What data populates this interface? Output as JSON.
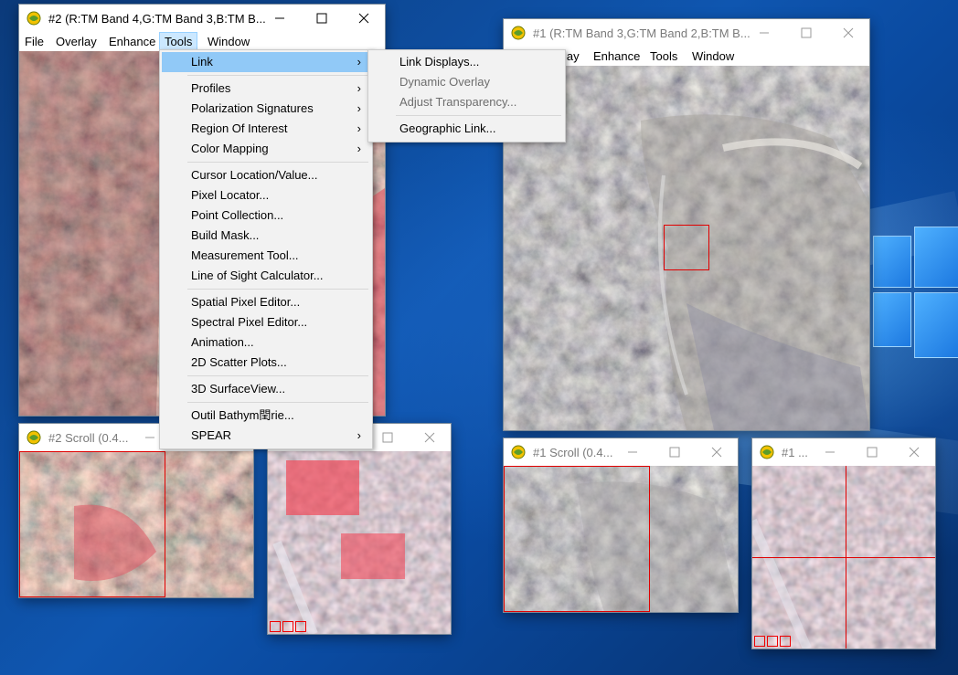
{
  "window_main2": {
    "title": "#2 (R:TM Band 4,G:TM Band 3,B:TM B...",
    "menu": [
      "File",
      "Overlay",
      "Enhance",
      "Tools",
      "Window"
    ]
  },
  "window_main1": {
    "title": "#1 (R:TM Band 3,G:TM Band 2,B:TM B...",
    "menu_partial": "lay",
    "menu": [
      "Enhance",
      "Tools",
      "Window"
    ]
  },
  "window_scroll2": {
    "title": "#2 Scroll (0.4..."
  },
  "window_scroll1": {
    "title": "#1 Scroll (0.4..."
  },
  "window_zoom1": {
    "title": "#1 ..."
  },
  "tools_menu": {
    "items": [
      {
        "label": "Link",
        "submenu": true
      },
      {
        "label": "Profiles",
        "submenu": true
      },
      {
        "label": "Polarization Signatures",
        "submenu": true
      },
      {
        "label": "Region Of Interest",
        "submenu": true
      },
      {
        "label": "Color Mapping",
        "submenu": true
      },
      {
        "label": "Cursor Location/Value..."
      },
      {
        "label": "Pixel Locator..."
      },
      {
        "label": "Point Collection..."
      },
      {
        "label": "Build Mask..."
      },
      {
        "label": "Measurement Tool..."
      },
      {
        "label": "Line of Sight Calculator..."
      },
      {
        "label": "Spatial Pixel Editor..."
      },
      {
        "label": "Spectral Pixel Editor..."
      },
      {
        "label": "Animation..."
      },
      {
        "label": "2D Scatter Plots..."
      },
      {
        "label": "3D SurfaceView..."
      },
      {
        "label": "Outil Bathym閏rie..."
      },
      {
        "label": "SPEAR",
        "submenu": true
      }
    ]
  },
  "link_submenu": {
    "items": [
      {
        "label": "Link Displays...",
        "enabled": true
      },
      {
        "label": "Dynamic Overlay",
        "enabled": false
      },
      {
        "label": "Adjust Transparency...",
        "enabled": false
      },
      {
        "label": "Geographic Link...",
        "enabled": true
      }
    ]
  },
  "icons": {
    "submenu_arrow": "›",
    "app": "envi-globe-icon",
    "minimize": "minimize-icon",
    "maximize": "maximize-icon",
    "close": "close-icon"
  },
  "colors": {
    "menu_highlight": "#91c9f7",
    "menubar_active": "#cce8ff",
    "roi_red": "#e00000"
  }
}
